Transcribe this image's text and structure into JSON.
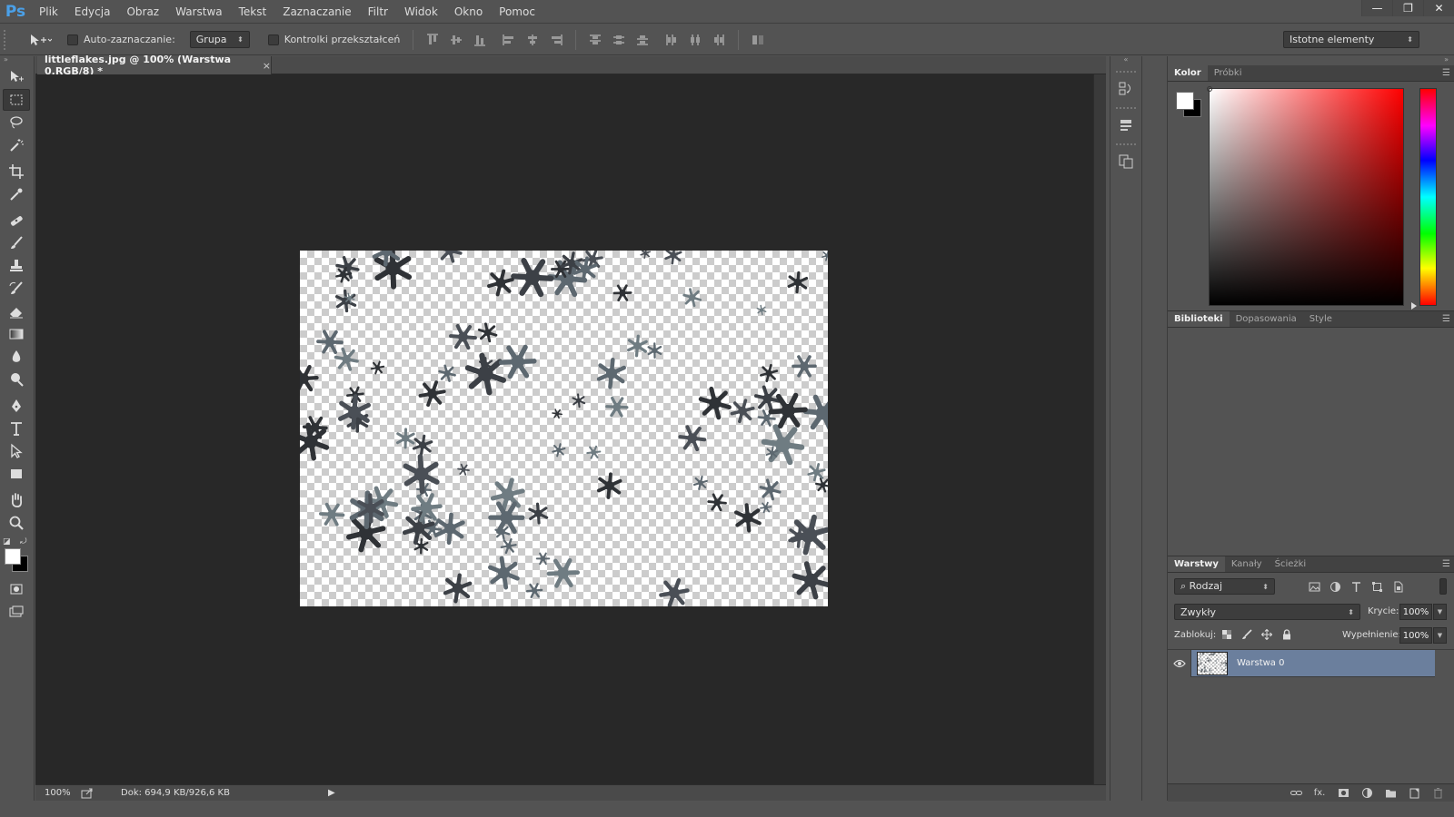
{
  "app": {
    "logo": "Ps"
  },
  "menu": [
    "Plik",
    "Edycja",
    "Obraz",
    "Warstwa",
    "Tekst",
    "Zaznaczanie",
    "Filtr",
    "Widok",
    "Okno",
    "Pomoc"
  ],
  "window_controls": {
    "minimize": "—",
    "restore": "❐",
    "close": "✕"
  },
  "options": {
    "auto_select_label": "Auto-zaznaczanie:",
    "auto_select_value": "Grupa",
    "transform_controls_label": "Kontrolki przekształceń",
    "workspace_value": "Istotne elementy"
  },
  "document": {
    "tab_title": "littleflakes.jpg @ 100% (Warstwa 0,RGB/8) *",
    "tab_close": "×",
    "zoom": "100%",
    "doc_info": "Dok: 694,9 KB/926,6 KB",
    "status_arrow": "▶"
  },
  "color_panel": {
    "tabs": [
      "Kolor",
      "Próbki"
    ],
    "foreground": "#ffffff",
    "background": "#000000",
    "hue_color": "#ff0000"
  },
  "libraries_panel": {
    "tabs": [
      "Biblioteki",
      "Dopasowania",
      "Style"
    ]
  },
  "layers_panel": {
    "tabs": [
      "Warstwy",
      "Kanały",
      "Ścieżki"
    ],
    "kind_filter": "Rodzaj",
    "blend_mode": "Zwykły",
    "opacity_label": "Krycie:",
    "opacity_value": "100%",
    "lock_label": "Zablokuj:",
    "fill_label": "Wypełnienie:",
    "fill_value": "100%",
    "layers": [
      {
        "name": "Warstwa 0",
        "visible": true,
        "selected": true
      }
    ]
  },
  "colors": {
    "ui_bg": "#535353",
    "canvas_bg": "#282828",
    "selected_layer": "#6b7f9d",
    "ps_blue": "#4aa0e8"
  }
}
